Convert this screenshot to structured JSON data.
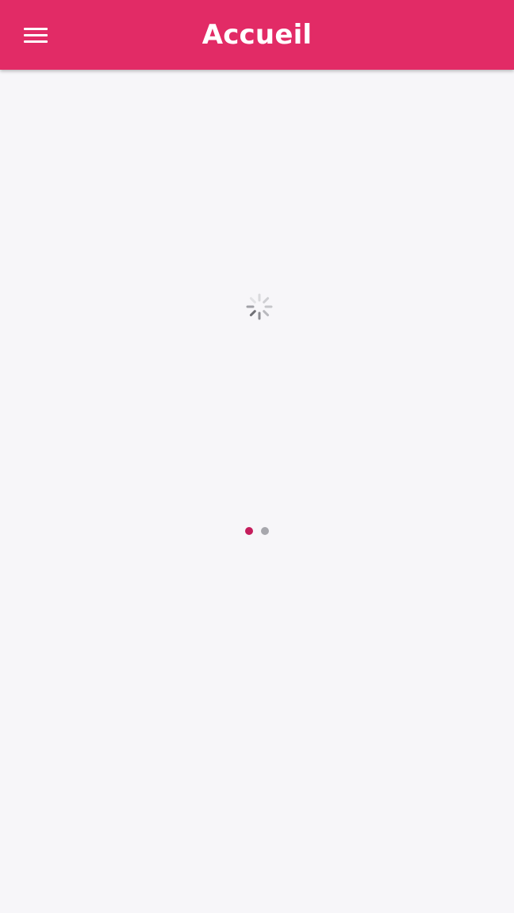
{
  "header": {
    "title": "Accueil",
    "background_color": "#e22b66",
    "menu_icon": "menu-icon"
  },
  "main": {
    "loading_icon": "loading-spinner-icon",
    "pager": {
      "active_index": 0,
      "dots": [
        {
          "name": "page-dot-1",
          "color": "#c51d5c"
        },
        {
          "name": "page-dot-2",
          "color": "#a7a7ad"
        }
      ]
    }
  }
}
